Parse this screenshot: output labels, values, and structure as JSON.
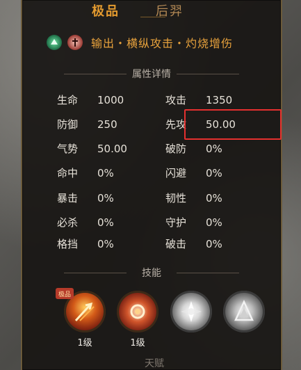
{
  "tabs": {
    "active": "极品",
    "inactive": "后羿"
  },
  "tags": {
    "icons": [
      "green-emblem-icon",
      "red-emblem-icon"
    ],
    "text": "输出・横纵攻击・灼烧增伤"
  },
  "sections": {
    "attributes_title": "属性详情",
    "skills_title": "技能"
  },
  "attributes": [
    {
      "label": "生命",
      "value": "1000",
      "side": "left"
    },
    {
      "label": "攻击",
      "value": "1350",
      "side": "right"
    },
    {
      "label": "防御",
      "value": "250",
      "side": "left"
    },
    {
      "label": "先攻",
      "value": "50.00",
      "side": "right",
      "highlighted": true
    },
    {
      "label": "气势",
      "value": "50.00",
      "side": "left"
    },
    {
      "label": "破防",
      "value": "0%",
      "side": "right"
    },
    {
      "label": "命中",
      "value": "0%",
      "side": "left"
    },
    {
      "label": "闪避",
      "value": "0%",
      "side": "right"
    },
    {
      "label": "暴击",
      "value": "0%",
      "side": "left"
    },
    {
      "label": "韧性",
      "value": "0%",
      "side": "right"
    },
    {
      "label": "必杀",
      "value": "0%",
      "side": "left"
    },
    {
      "label": "守护",
      "value": "0%",
      "side": "right"
    },
    {
      "label": "格挡",
      "value": "0%",
      "side": "left"
    },
    {
      "label": "破击",
      "value": "0%",
      "side": "right"
    }
  ],
  "skills": [
    {
      "icon": "arrow-strike-skill-icon",
      "level": "1级",
      "badge": "极品"
    },
    {
      "icon": "flame-burst-skill-icon",
      "level": "1级"
    },
    {
      "icon": "white-crest-skill-icon"
    },
    {
      "icon": "silver-crest-skill-icon"
    }
  ],
  "colors": {
    "accent": "#e39a2f",
    "highlight_border": "#e5302f",
    "panel_bg": "#181614"
  },
  "bottom_partial_text": "天赋"
}
